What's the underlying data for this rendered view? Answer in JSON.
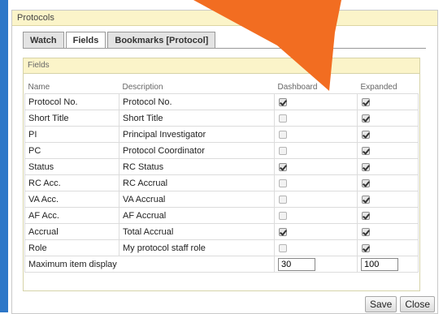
{
  "panel": {
    "title": "Protocols"
  },
  "tabs": [
    {
      "label": "Watch",
      "active": false
    },
    {
      "label": "Fields",
      "active": true
    },
    {
      "label": "Bookmarks [Protocol]",
      "active": false
    }
  ],
  "fields": {
    "header": "Fields",
    "columns": {
      "name": "Name",
      "description": "Description",
      "dashboard": "Dashboard",
      "expanded": "Expanded"
    },
    "rows": [
      {
        "name": "Protocol No.",
        "description": "Protocol No.",
        "dashboard": true,
        "expanded": true
      },
      {
        "name": "Short Title",
        "description": "Short Title",
        "dashboard": false,
        "expanded": true
      },
      {
        "name": "PI",
        "description": "Principal Investigator",
        "dashboard": false,
        "expanded": true
      },
      {
        "name": "PC",
        "description": "Protocol Coordinator",
        "dashboard": false,
        "expanded": true
      },
      {
        "name": "Status",
        "description": "RC Status",
        "dashboard": true,
        "expanded": true
      },
      {
        "name": "RC Acc.",
        "description": "RC Accrual",
        "dashboard": false,
        "expanded": true
      },
      {
        "name": "VA Acc.",
        "description": "VA Accrual",
        "dashboard": false,
        "expanded": true
      },
      {
        "name": "AF Acc.",
        "description": "AF Accrual",
        "dashboard": false,
        "expanded": true
      },
      {
        "name": "Accrual",
        "description": "Total Accrual",
        "dashboard": true,
        "expanded": true
      },
      {
        "name": "Role",
        "description": "My protocol staff role",
        "dashboard": false,
        "expanded": true
      }
    ],
    "max_display": {
      "label": "Maximum item display",
      "dashboard_value": "30",
      "expanded_value": "100"
    }
  },
  "buttons": {
    "save": "Save",
    "close": "Close"
  },
  "colors": {
    "arrow": "#f26d21",
    "frame_border": "#2d77c8",
    "header_bg": "#fbf4c9"
  }
}
